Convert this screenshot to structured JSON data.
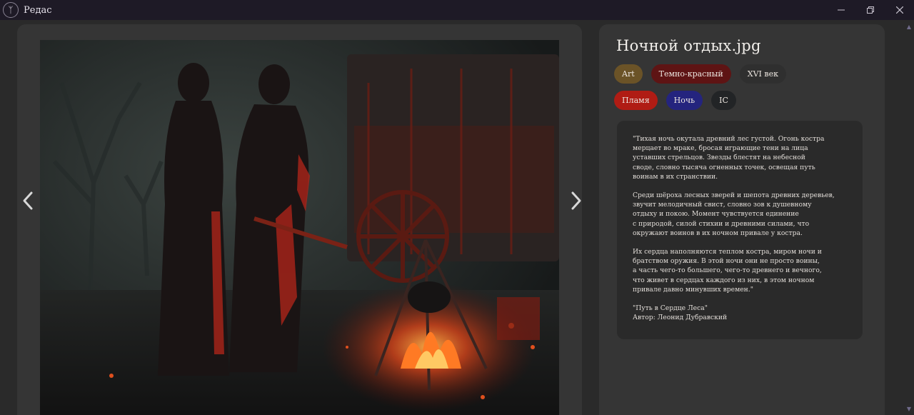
{
  "app": {
    "title": "Редас",
    "logo_icon": "rune-tree-icon",
    "controls": {
      "minimize": "—",
      "maximize": "❐",
      "close": "✕"
    }
  },
  "viewer": {
    "prev_icon": "chevron-left-icon",
    "next_icon": "chevron-right-icon",
    "image_subject": "night-campfire-painting"
  },
  "info": {
    "file_name": "Ночной отдых.jpg",
    "tags_row1": [
      {
        "label": "Art",
        "color": "#6b5327"
      },
      {
        "label": "Темно-красный",
        "color": "#5e1414"
      },
      {
        "label": "XVI век",
        "color": "#2f2f2f"
      }
    ],
    "tags_row2": [
      {
        "label": "Пламя",
        "color": "#b01c14"
      },
      {
        "label": "Ночь",
        "color": "#24247e"
      },
      {
        "label": "IC",
        "color": "#222426"
      }
    ],
    "quote": {
      "p1": "\"Тихая ночь окутала древний лес густой. Огонь костра\nмерцает во мраке, бросая играющие тени на лица\nуставших стрельцов. Звезды блестят на небесной\nсводе, словно тысяча огненных точек, освещая путь\nвоинам в их странствии.",
      "p2": "Среди шёроха лесных зверей и шепота древних деревьев,\nзвучит мелодичный свист, словно зов к душевному\nотдыху и покою. Момент чувствуется единение\nс природой, силой стихии и древними силами, что\nокружают воинов в их ночном привале у костра.",
      "p3": "Их сердца наполняются теплом костра, миром ночи и\nбратством оружия. В этой ночи они не просто воины,\nа часть чего-то большего, чего-то древнего и вечного,\nчто живет в сердцах каждого из них, в этом ночном\nпривале давно минувших времен.\"",
      "source": "\"Путь в Сердце Леса\"",
      "author": "Автор: Леонид Дубравский"
    }
  },
  "colors": {
    "background": "#2a2a2a",
    "panel": "#353535",
    "titlebar": "#1e1a26",
    "fire": "#e04a1c"
  }
}
